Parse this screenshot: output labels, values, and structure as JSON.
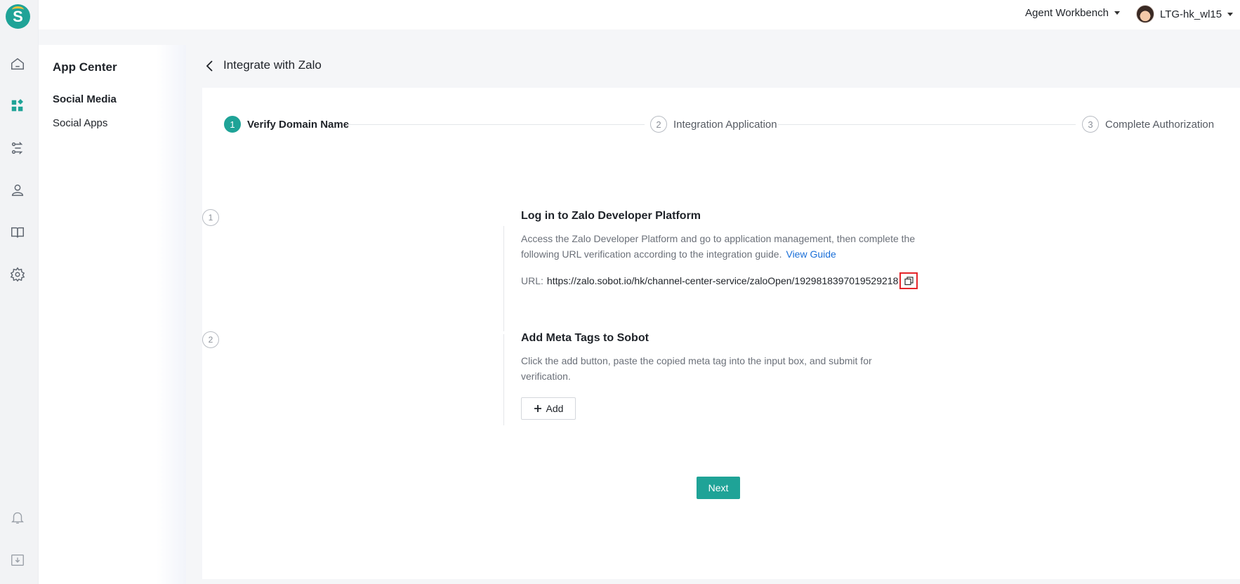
{
  "app": {
    "logo_letter": "S"
  },
  "rail": {
    "icons": [
      "home-icon",
      "apps-icon",
      "routing-icon",
      "contacts-icon",
      "knowledge-book-icon",
      "settings-gear-icon",
      "bell-icon",
      "download-icon"
    ]
  },
  "topbar": {
    "workspace_label": "Agent Workbench",
    "user_name": "LTG-hk_wl15"
  },
  "subnav": {
    "title": "App Center",
    "items": [
      {
        "label": "Social Media",
        "active": true
      },
      {
        "label": "Social Apps",
        "active": false
      }
    ]
  },
  "header": {
    "title": "Integrate with Zalo"
  },
  "steps": [
    {
      "num": "1",
      "label": "Verify Domain Name",
      "active": true
    },
    {
      "num": "2",
      "label": "Integration Application",
      "active": false
    },
    {
      "num": "3",
      "label": "Complete Authorization",
      "active": false
    }
  ],
  "sections": {
    "login": {
      "num": "1",
      "title": "Log in to Zalo Developer Platform",
      "desc_line1": "Access the Zalo Developer Platform and go to application management, then complete the",
      "desc_line2": "following URL verification according to the integration guide.",
      "link": "View Guide",
      "url_key": "URL:",
      "url_value": "https://zalo.sobot.io/hk/channel-center-service/zaloOpen/1929818397019529218"
    },
    "meta": {
      "num": "2",
      "title": "Add Meta Tags to Sobot",
      "desc_line1": "Click the add button, paste the copied meta tag into the input box, and submit for",
      "desc_line2": "verification.",
      "add_label": "Add"
    }
  },
  "footer": {
    "next_label": "Next"
  },
  "colors": {
    "accent": "#1fa397",
    "link": "#1a6fd8",
    "highlight": "#e5252a"
  }
}
